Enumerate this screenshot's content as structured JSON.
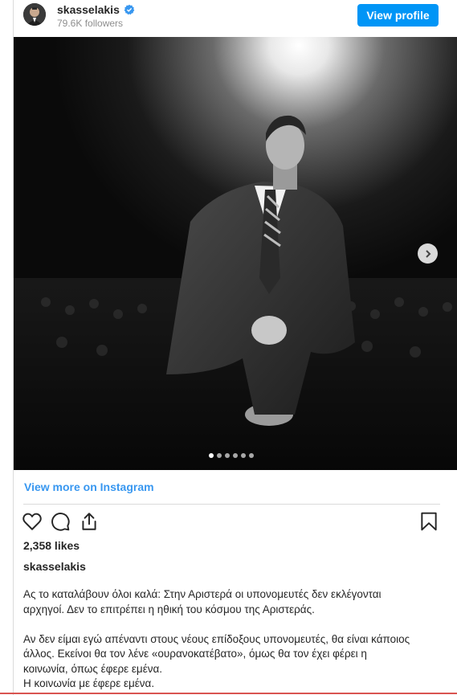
{
  "header": {
    "username": "skasselakis",
    "followers": "79.6K followers",
    "view_profile_label": "View profile",
    "verified_icon": "verified-badge-icon"
  },
  "media": {
    "carousel_dots": 6,
    "active_dot": 1,
    "next_icon": "chevron-right-icon"
  },
  "view_more_label": "View more on Instagram",
  "actions": {
    "like_icon": "heart-icon",
    "comment_icon": "comment-icon",
    "share_icon": "share-icon",
    "save_icon": "bookmark-icon"
  },
  "likes": "2,358 likes",
  "caption": {
    "username": "skasselakis",
    "line1": "Ας το καταλάβουν όλοι καλά: Στην Αριστερά οι υπονομευτές δεν εκλέγονται",
    "line2": "αρχηγοί. Δεν το επιτρέπει η ηθική του κόσμου της Αριστεράς.",
    "line3": "Αν δεν είμαι εγώ απέναντι στους νέους επίδοξους υπονομευτές, θα είναι κάποιος",
    "line4": "άλλος. Εκείνοι θα τον λένε «ουρανοκατέβατο», όμως θα τον έχει φέρει η",
    "line5": "κοινωνία, όπως έφερε εμένα.",
    "line6": "Η κοινωνία με έφερε εμένα."
  }
}
